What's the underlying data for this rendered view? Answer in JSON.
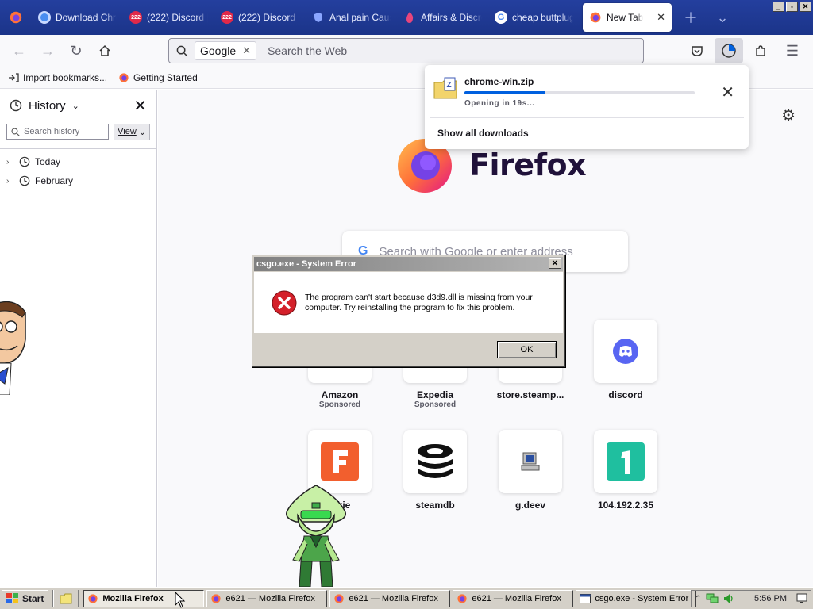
{
  "tabs": [
    {
      "label": "Download Chro",
      "icon": "chrome-icon"
    },
    {
      "label": "(222) Discord |",
      "icon": "discord-badge-icon",
      "badge": "222"
    },
    {
      "label": "(222) Discord |",
      "icon": "discord-badge-icon",
      "badge": "222"
    },
    {
      "label": "Anal pain Caus",
      "icon": "shield-icon"
    },
    {
      "label": "Affairs & Discre",
      "icon": "flame-icon"
    },
    {
      "label": "cheap buttplug",
      "icon": "google-icon"
    },
    {
      "label": "New Tab",
      "icon": "firefox-icon",
      "active": true
    }
  ],
  "window_controls": [
    "_",
    "▫",
    "✕"
  ],
  "nav": {
    "engine": "Google",
    "url_placeholder": "Search the Web"
  },
  "bookmarks": [
    {
      "label": "Import bookmarks...",
      "icon": "import-icon"
    },
    {
      "label": "Getting Started",
      "icon": "firefox-icon"
    }
  ],
  "sidebar": {
    "title": "History",
    "search_placeholder": "Search history",
    "view_label": "View",
    "items": [
      {
        "label": "Today"
      },
      {
        "label": "February"
      }
    ]
  },
  "newtab": {
    "brand": "Firefox",
    "search_placeholder": "Search with Google or enter address",
    "tiles_row1": [
      {
        "label": "Amazon",
        "sponsored": "Sponsored"
      },
      {
        "label": "Expedia",
        "sponsored": "Sponsored"
      },
      {
        "label": "store.steamp...",
        "sponsored": ""
      },
      {
        "label": "discord",
        "sponsored": ""
      }
    ],
    "tiles_row2": [
      {
        "label": "...kie",
        "color": "#f25f2e"
      },
      {
        "label": "steamdb",
        "color": "#000000"
      },
      {
        "label": "g.deev",
        "color": "#808080"
      },
      {
        "label": "104.192.2.35",
        "color": "#1fbf9f"
      }
    ]
  },
  "downloads": {
    "filename": "chrome-win.zip",
    "status": "Opening in 19s...",
    "progress": 0.35,
    "show_all": "Show all downloads"
  },
  "dialog": {
    "title": "csgo.exe - System Error",
    "message": "The program can't start because d3d9.dll is missing from your computer. Try reinstalling the program to fix this problem.",
    "ok": "OK"
  },
  "taskbar": {
    "start": "Start",
    "tasks": [
      {
        "label": "Mozilla Firefox",
        "active": true
      },
      {
        "label": "e621 — Mozilla Firefox"
      },
      {
        "label": "e621 — Mozilla Firefox"
      },
      {
        "label": "e621 — Mozilla Firefox"
      },
      {
        "label": "csgo.exe - System Error"
      }
    ],
    "clock": "5:56 PM"
  },
  "colors": {
    "tabstrip": "#1f3a93",
    "accent": "#0060df",
    "error_red": "#d4202a",
    "discord": "#5865f2",
    "win_face": "#d4d0c8"
  }
}
